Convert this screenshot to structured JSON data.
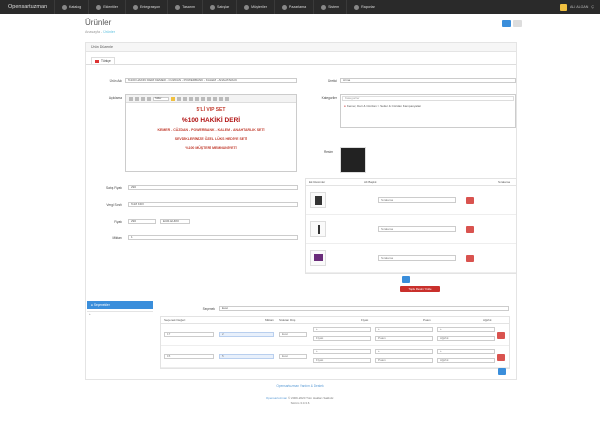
{
  "app": {
    "brand": "Opensartuzman"
  },
  "topnav": [
    {
      "label": "Katalog",
      "icon": "tag-icon"
    },
    {
      "label": "Eklentiler",
      "icon": "puzzle-icon"
    },
    {
      "label": "Entegrasyon",
      "icon": "plug-icon"
    },
    {
      "label": "Tasarım",
      "icon": "monitor-icon"
    },
    {
      "label": "Satışlar",
      "icon": "cart-icon"
    },
    {
      "label": "Müşteriler",
      "icon": "user-icon"
    },
    {
      "label": "Pazarlama",
      "icon": "share-icon"
    },
    {
      "label": "Sistem",
      "icon": "gear-icon"
    },
    {
      "label": "Raporlar",
      "icon": "chart-icon"
    }
  ],
  "user": {
    "name": "ALI ALGAN",
    "logout": "Ç"
  },
  "header": {
    "title": "Ürünler",
    "breadcrumb_home": "Anasayfa",
    "breadcrumb_sep": " - ",
    "breadcrumb_current": "Ürünler"
  },
  "panel": {
    "heading": "Ürün Düzenle",
    "language_tab": "Türkçe"
  },
  "form": {
    "name_label": "Ürün Adı",
    "name_value": "%100 HAKİKİ DERİ KEMER - CÜZDAN - POWERBANK - KALEM - ANAHTARLIK",
    "description_label": "Açıklama",
    "editor_style": "Stiller",
    "editor_lines": [
      "5'Lİ VIP SET",
      "%100 HAKİKİ DERİ",
      "KEMER - CÜZDAN - POWERBANK - KALEM - ANAHTARLIK SETİ",
      "SEVDİKLERİNİZE ÖZEL LÜKS HEDİYE SETİ",
      "%100 MÜŞTERİ MEMNUNİYETİ"
    ],
    "brand_label": "Üretici",
    "brand_value": "Arma",
    "category_label": "Kategoriler",
    "category_placeholder": "Kategoriler",
    "category_item": "Kemer, Deri & Cüzdan > Setler & Cüzdan Kampanyaları",
    "image_label": "Resim",
    "price_label": "Satış Fiyatı",
    "price_value": "290",
    "tax_label": "Vergi Sınıfı",
    "tax_value": "%18 KDV",
    "sale_price_label": "Fiyatı",
    "sale_price_value": "290",
    "currency_value": "EUR-EURO",
    "stock_label": "Miktarı",
    "stock_value": "1"
  },
  "images": {
    "col_image": "Ek Resimler",
    "col_alt": "Alt Başlık",
    "col_sort": "Sıralama",
    "sort_placeholder": "Sıralama",
    "add_tooltip_label": "Toplu Resim Yükle"
  },
  "sidebar": {
    "active_item": "Seçenekler",
    "second_item": "+"
  },
  "variants": {
    "option_label": "Seçenek",
    "option_value": "Evet",
    "col_value": "Seçenek Değeri",
    "col_qty": "Miktarı",
    "col_subtract": "Stoktan Düş",
    "col_price": "Fiyatı",
    "col_points": "Puanı",
    "col_weight": "Ağırlık",
    "rows": [
      {
        "value": "17",
        "qty": "2",
        "subtract": "Evet",
        "price_sign": "+",
        "price": "Fiyatı",
        "points_sign": "+",
        "points": "Puanı",
        "weight_sign": "+",
        "weight": "Ağırlık"
      },
      {
        "value": "15",
        "qty": "5",
        "subtract": "Evet",
        "price_sign": "+",
        "price": "Fiyatı",
        "points_sign": "+",
        "points": "Puanı",
        "weight_sign": "+",
        "weight": "Ağırlık"
      }
    ]
  },
  "footer": {
    "link": "Opensartuzman Yardım & Destek",
    "line1_link": "Opensartuzman",
    "line1_text": " © 2009-2020 Tüm Hakları Saklıdır.",
    "version": "Sürüm 3.0.3.6"
  },
  "colors": {
    "primary": "#3a8edb",
    "danger": "#d9534f",
    "topbar": "#2a2a2a"
  }
}
